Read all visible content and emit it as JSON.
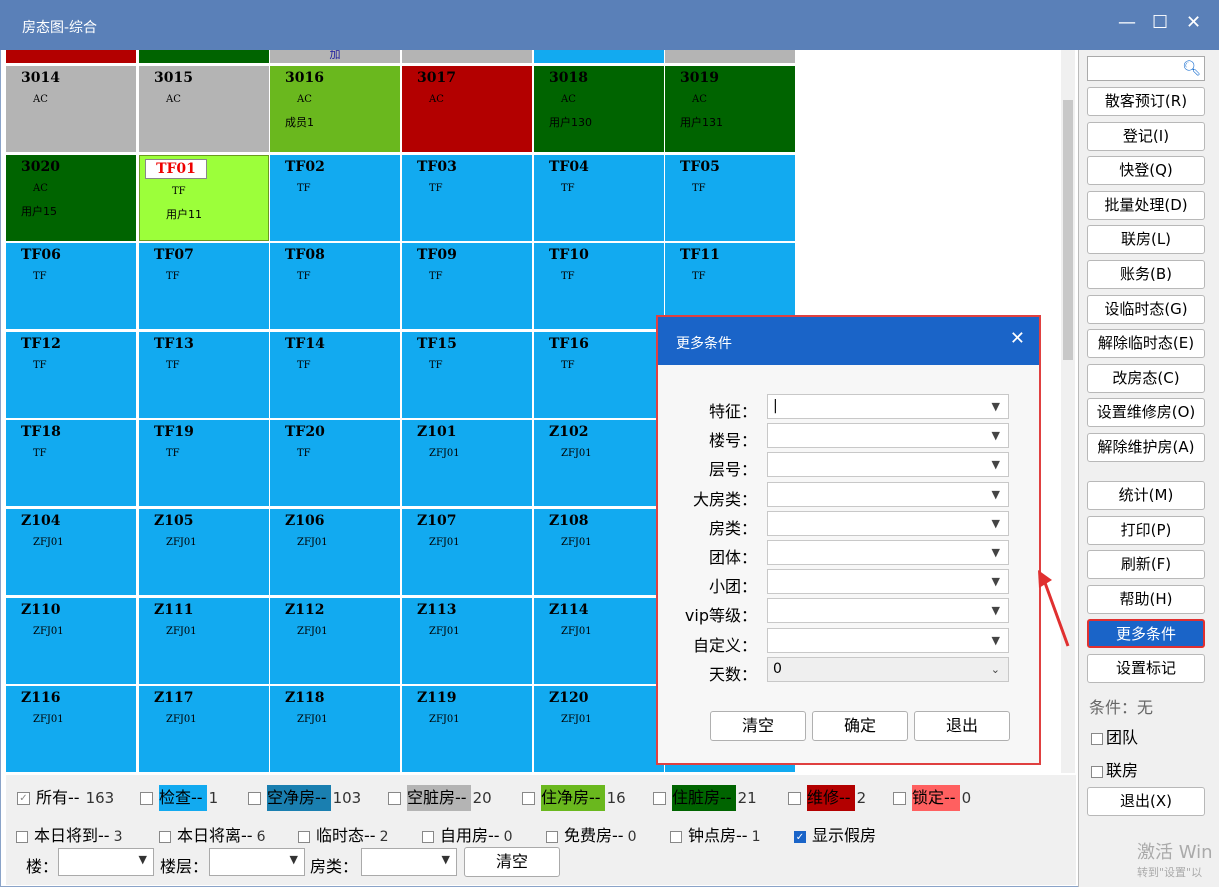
{
  "window": {
    "title": "房态图-综合",
    "minimize": "—",
    "maximize": "☐",
    "close": "✕"
  },
  "colors": {
    "inspect": "#12aaf0",
    "vacant_clean": "#1a7fb0",
    "vacant_dirty": "#b4b4b4",
    "occupied_clean": "#6ab81e",
    "occupied_dirty": "#006400",
    "maintenance": "#b30000",
    "locked": "#ff6060",
    "selected": "#9cff3a"
  },
  "top_strip": [
    {
      "color": "#b30000",
      "text": ""
    },
    {
      "color": "#006400",
      "text": ""
    },
    {
      "color": "#b4b4b4",
      "text": "加"
    },
    {
      "color": "#b4b4b4",
      "text": ""
    },
    {
      "color": "#12aaf0",
      "text": ""
    },
    {
      "color": "#b4b4b4",
      "text": ""
    }
  ],
  "rooms": [
    [
      {
        "num": "3014",
        "code": "AC",
        "guest": "",
        "status": "vacant_dirty"
      },
      {
        "num": "3015",
        "code": "AC",
        "guest": "",
        "status": "vacant_dirty"
      },
      {
        "num": "3016",
        "code": "AC",
        "guest": "成员1",
        "status": "occupied_clean"
      },
      {
        "num": "3017",
        "code": "AC",
        "guest": "",
        "status": "maintenance"
      },
      {
        "num": "3018",
        "code": "AC",
        "guest": "用户130",
        "status": "occupied_dirty"
      },
      {
        "num": "3019",
        "code": "AC",
        "guest": "用户131",
        "status": "occupied_dirty"
      }
    ],
    [
      {
        "num": "3020",
        "code": "AC",
        "guest": "用户15",
        "status": "occupied_dirty"
      },
      {
        "num": "TF01",
        "code": "TF",
        "guest": "用户11",
        "status": "selected",
        "tagged": true
      },
      {
        "num": "TF02",
        "code": "TF",
        "guest": "",
        "status": "inspect"
      },
      {
        "num": "TF03",
        "code": "TF",
        "guest": "",
        "status": "inspect"
      },
      {
        "num": "TF04",
        "code": "TF",
        "guest": "",
        "status": "inspect"
      },
      {
        "num": "TF05",
        "code": "TF",
        "guest": "",
        "status": "inspect"
      }
    ],
    [
      {
        "num": "TF06",
        "code": "TF",
        "guest": "",
        "status": "inspect"
      },
      {
        "num": "TF07",
        "code": "TF",
        "guest": "",
        "status": "inspect"
      },
      {
        "num": "TF08",
        "code": "TF",
        "guest": "",
        "status": "inspect"
      },
      {
        "num": "TF09",
        "code": "TF",
        "guest": "",
        "status": "inspect"
      },
      {
        "num": "TF10",
        "code": "TF",
        "guest": "",
        "status": "inspect"
      },
      {
        "num": "TF11",
        "code": "TF",
        "guest": "",
        "status": "inspect"
      }
    ],
    [
      {
        "num": "TF12",
        "code": "TF",
        "guest": "",
        "status": "inspect"
      },
      {
        "num": "TF13",
        "code": "TF",
        "guest": "",
        "status": "inspect"
      },
      {
        "num": "TF14",
        "code": "TF",
        "guest": "",
        "status": "inspect"
      },
      {
        "num": "TF15",
        "code": "TF",
        "guest": "",
        "status": "inspect"
      },
      {
        "num": "TF16",
        "code": "TF",
        "guest": "",
        "status": "inspect"
      },
      {
        "num": "",
        "code": "",
        "guest": "",
        "status": "inspect"
      }
    ],
    [
      {
        "num": "TF18",
        "code": "TF",
        "guest": "",
        "status": "inspect"
      },
      {
        "num": "TF19",
        "code": "TF",
        "guest": "",
        "status": "inspect"
      },
      {
        "num": "TF20",
        "code": "TF",
        "guest": "",
        "status": "inspect"
      },
      {
        "num": "Z101",
        "code": "ZFJ01",
        "guest": "",
        "status": "inspect"
      },
      {
        "num": "Z102",
        "code": "ZFJ01",
        "guest": "",
        "status": "inspect"
      },
      {
        "num": "",
        "code": "",
        "guest": "",
        "status": "inspect"
      }
    ],
    [
      {
        "num": "Z104",
        "code": "ZFJ01",
        "guest": "",
        "status": "inspect"
      },
      {
        "num": "Z105",
        "code": "ZFJ01",
        "guest": "",
        "status": "inspect"
      },
      {
        "num": "Z106",
        "code": "ZFJ01",
        "guest": "",
        "status": "inspect"
      },
      {
        "num": "Z107",
        "code": "ZFJ01",
        "guest": "",
        "status": "inspect"
      },
      {
        "num": "Z108",
        "code": "ZFJ01",
        "guest": "",
        "status": "inspect"
      },
      {
        "num": "",
        "code": "",
        "guest": "",
        "status": "inspect"
      }
    ],
    [
      {
        "num": "Z110",
        "code": "ZFJ01",
        "guest": "",
        "status": "inspect"
      },
      {
        "num": "Z111",
        "code": "ZFJ01",
        "guest": "",
        "status": "inspect"
      },
      {
        "num": "Z112",
        "code": "ZFJ01",
        "guest": "",
        "status": "inspect"
      },
      {
        "num": "Z113",
        "code": "ZFJ01",
        "guest": "",
        "status": "inspect"
      },
      {
        "num": "Z114",
        "code": "ZFJ01",
        "guest": "",
        "status": "inspect"
      },
      {
        "num": "",
        "code": "",
        "guest": "",
        "status": "inspect"
      }
    ],
    [
      {
        "num": "Z116",
        "code": "ZFJ01",
        "guest": "",
        "status": "inspect"
      },
      {
        "num": "Z117",
        "code": "ZFJ01",
        "guest": "",
        "status": "inspect"
      },
      {
        "num": "Z118",
        "code": "ZFJ01",
        "guest": "",
        "status": "inspect"
      },
      {
        "num": "Z119",
        "code": "ZFJ01",
        "guest": "",
        "status": "inspect"
      },
      {
        "num": "Z120",
        "code": "ZFJ01",
        "guest": "",
        "status": "inspect"
      },
      {
        "num": "",
        "code": "",
        "guest": "",
        "status": "inspect"
      }
    ]
  ],
  "sidebar": {
    "search_icon": "search-icon",
    "buttons": [
      "散客预订(R)",
      "登记(I)",
      "快登(Q)",
      "批量处理(D)",
      "联房(L)",
      "账务(B)",
      "设临时态(G)",
      "解除临时态(E)",
      "改房态(C)",
      "设置维修房(O)",
      "解除维护房(A)"
    ],
    "buttons2": [
      "统计(M)",
      "打印(P)",
      "刷新(F)",
      "帮助(H)",
      "更多条件",
      "设置标记"
    ],
    "condition_label": "条件：无",
    "checks": [
      "团队",
      "联房"
    ],
    "exit": "退出(X)"
  },
  "legend": [
    {
      "label": "所有--",
      "count": "163",
      "color": "#f0f0f0",
      "checked": true
    },
    {
      "label": "检查--",
      "count": "1",
      "color": "#12aaf0"
    },
    {
      "label": "空净房--",
      "count": "103",
      "color": "#1a7fb0"
    },
    {
      "label": "空脏房--",
      "count": "20",
      "color": "#b4b4b4"
    },
    {
      "label": "住净房--",
      "count": "16",
      "color": "#6ab81e"
    },
    {
      "label": "住脏房--",
      "count": "21",
      "color": "#006400"
    },
    {
      "label": "维修--",
      "count": "2",
      "color": "#b30000"
    },
    {
      "label": "锁定--",
      "count": "0",
      "color": "#ff6060"
    }
  ],
  "checks_row": [
    {
      "label": "本日将到--",
      "count": "3"
    },
    {
      "label": "本日将离--",
      "count": "6"
    },
    {
      "label": "临时态--",
      "count": "2"
    },
    {
      "label": "自用房--",
      "count": "0"
    },
    {
      "label": "免费房--",
      "count": "0"
    },
    {
      "label": "钟点房--",
      "count": "1"
    },
    {
      "label": "显示假房",
      "count": "",
      "checked": true
    }
  ],
  "filters": {
    "building": "楼：",
    "floor": "楼层：",
    "room_type": "房类：",
    "clear": "清空"
  },
  "dialog": {
    "title": "更多条件",
    "fields": [
      {
        "label": "特征：",
        "value": ""
      },
      {
        "label": "楼号：",
        "value": ""
      },
      {
        "label": "层号：",
        "value": ""
      },
      {
        "label": "大房类：",
        "value": ""
      },
      {
        "label": "房类：",
        "value": ""
      },
      {
        "label": "团体：",
        "value": ""
      },
      {
        "label": "小团：",
        "value": ""
      },
      {
        "label": "vip等级：",
        "value": ""
      },
      {
        "label": "自定义：",
        "value": ""
      },
      {
        "label": "天数：",
        "value": "0"
      }
    ],
    "buttons": [
      "清空",
      "确定",
      "退出"
    ]
  },
  "watermark": {
    "line1": "激活 Win",
    "line2": "转到\"设置\"以"
  }
}
